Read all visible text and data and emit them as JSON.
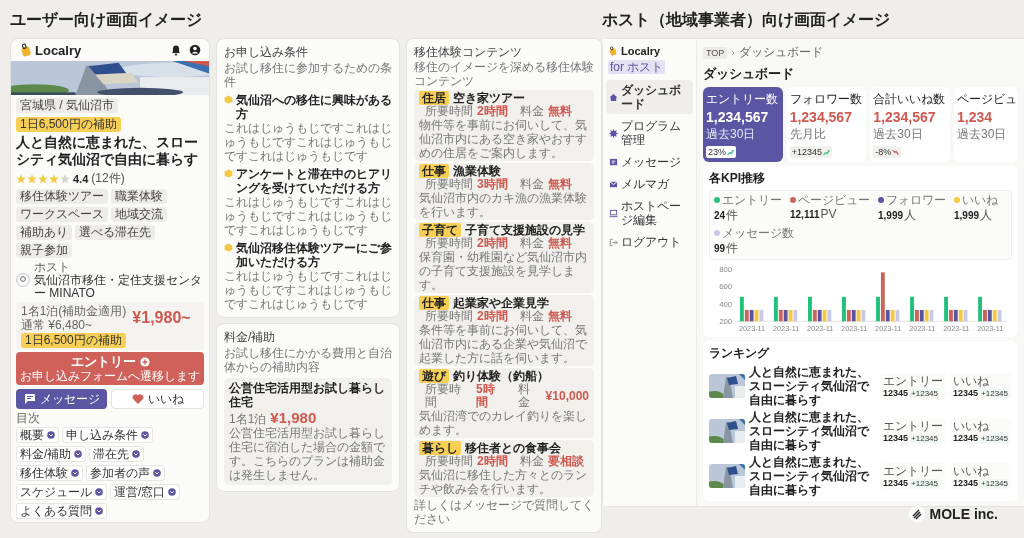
{
  "user_screen": {
    "heading": "ユーザー向け画面イメージ",
    "logo": "Localry",
    "location": "宮城県 / 気仙沼市",
    "subsidy": "1日6,500円の補助",
    "title": "人と自然に恵まれた、スローシティ気仙沼で自由に暮らす",
    "rating": {
      "stars": 4,
      "score": "4.4",
      "count": "(12件)"
    },
    "tags": [
      "移住体験ツアー",
      "職業体験",
      "ワークスペース",
      "地域交流",
      "補助あり",
      "選べる滞在先",
      "親子参加"
    ],
    "host": {
      "label": "ホスト",
      "name": "気仙沼市移住・定住支援センター MINATO"
    },
    "price": {
      "condition": "1名1泊(補助金適用)",
      "regular": "通常 ¥6,480~",
      "amount": "¥1,980~",
      "badge": "1日6,500円の補助"
    },
    "actions": [
      {
        "kind": "entry",
        "label": "エントリー",
        "sub": "お申し込みフォームへ遷移します"
      },
      {
        "kind": "message",
        "label": "メッセージ"
      },
      {
        "kind": "like",
        "label": "いいね"
      }
    ],
    "toc": {
      "title": "目次",
      "items": [
        "概要",
        "申し込み条件",
        "料金/補助",
        "滞在先",
        "移住体験",
        "参加者の声",
        "スケジュール",
        "運営/窓口",
        "よくある質問"
      ]
    }
  },
  "conditions": {
    "title": "お申し込み条件",
    "subtitle": "お試し移住に参加するための条件",
    "items": [
      {
        "title": "気仙沼への移住に興味がある方",
        "description": "これはじゅうもじですこれはじゅうもじですこれはじゅうもじですこれはじゅうもじです"
      },
      {
        "title": "アンケートと滞在中のヒアリングを受けていただける方",
        "description": "これはじゅうもじですこれはじゅうもじですこれはじゅうもじですこれはじゅうもじです"
      },
      {
        "title": "気仙沼移住体験ツアーにご参加いただける方",
        "description": "これはじゅうもじですこれはじゅうもじですこれはじゅうもじですこれはじゅうもじです"
      }
    ]
  },
  "fees": {
    "title": "料金/補助",
    "subtitle": "お試し移住にかかる費用と自治体からの補助内容",
    "plans": [
      {
        "title": "公営住宅活用型お試し暮らし住宅",
        "unit": "1名1泊",
        "amount": "¥1,980",
        "description": "公営住宅活用型お試し暮らし住宅に宿泊した場合の金額です。こちらのプランは補助金は発生しません。"
      }
    ]
  },
  "experiences": {
    "title": "移住体験コンテンツ",
    "subtitle": "移住のイメージを深める移住体験コンテンツ",
    "items": [
      {
        "category": "住居",
        "title": "空き家ツアー",
        "duration_label": "所要時間",
        "duration": "2時間",
        "fee_label": "料金",
        "fee": "無料",
        "description": "物件等を事前にお伺いして、気仙沼市内にある空き家やおすすめの住居をご案内します。"
      },
      {
        "category": "仕事",
        "title": "漁業体験",
        "duration_label": "所要時間",
        "duration": "3時間",
        "fee_label": "料金",
        "fee": "無料",
        "description": "気仙沼市内のカキ漁の漁業体験を行います。"
      },
      {
        "category": "子育て",
        "title": "子育て支援施設の見学",
        "duration_label": "所要時間",
        "duration": "2時間",
        "fee_label": "料金",
        "fee": "無料",
        "description": "保育園・幼稚園など気仙沼市内の子育て支援施設を見学します。"
      },
      {
        "category": "仕事",
        "title": "起業家や企業見学",
        "duration_label": "所要時間",
        "duration": "2時間",
        "fee_label": "料金",
        "fee": "無料",
        "description": "条件等を事前にお伺いして、気仙沼市内にある企業や気仙沼で起業した方に話を伺います。"
      },
      {
        "category": "遊び",
        "title": "釣り体験（釣船）",
        "duration_label": "所要時間",
        "duration": "5時間",
        "fee_label": "料金",
        "fee": "¥10,000",
        "description": "気仙沼湾でのカレイ釣りを楽しめます。"
      },
      {
        "category": "暮らし",
        "title": "移住者との食事会",
        "duration_label": "所要時間",
        "duration": "2時間",
        "fee_label": "料金",
        "fee": "要相談",
        "description": "気仙沼に移住した方々とのランチや飲み会を行います。"
      }
    ],
    "footer": "詳しくはメッセージで質問してください"
  },
  "host_screen": {
    "heading": "ホスト（地域事業者）向け画面イメージ",
    "logo": "Localry",
    "badge": "for ホスト",
    "nav": [
      {
        "kind": "home",
        "label": "ダッシュボード",
        "selected": true
      },
      {
        "kind": "program",
        "label": "プログラム管理",
        "selected": false
      },
      {
        "kind": "message",
        "label": "メッセージ",
        "selected": false
      },
      {
        "kind": "mail",
        "label": "メルマガ",
        "selected": false
      },
      {
        "kind": "page",
        "label": "ホストページ編集",
        "selected": false
      },
      {
        "kind": "logout",
        "label": "ログアウト",
        "selected": false
      }
    ],
    "breadcrumb": [
      "TOP",
      "ダッシュボード"
    ],
    "page_title": "ダッシュボード",
    "kpi_cards": [
      {
        "label": "エントリー数",
        "value": "1,234,567",
        "caption": "過去30日",
        "change": "23%",
        "kind": "up",
        "selected": true
      },
      {
        "label": "フォロワー数",
        "value": "1,234,567",
        "caption": "先月比",
        "change": "+12345",
        "kind": "up",
        "selected": false
      },
      {
        "label": "合計いいね数",
        "value": "1,234,567",
        "caption": "過去30日",
        "change": "-8%",
        "kind": "down",
        "selected": false
      },
      {
        "label": "ページビュ",
        "value": "1,234",
        "caption": "過去30日",
        "selected": false
      }
    ],
    "kpi_trend": {
      "title": "各KPI推移",
      "legend": [
        {
          "value": "24",
          "unit": "件"
        },
        {
          "value": "12,111",
          "unit": "PV"
        },
        {
          "value": "1,999",
          "unit": "人"
        },
        {
          "value": "1,999",
          "unit": "人"
        },
        {
          "value": "99",
          "unit": "件"
        }
      ],
      "chart_data": {
        "type": "bar",
        "categories": [
          "2023-11",
          "2023-11",
          "2023-11",
          "2023-11",
          "2023-11",
          "2023-11",
          "2023-11",
          "2023-11"
        ],
        "ylim": [
          200,
          800
        ],
        "yticks": [
          200,
          400,
          600,
          800
        ],
        "series": [
          {
            "name": "エントリー",
            "color": "#22c07a",
            "values": [
              480,
              480,
              480,
              480,
              480,
              480,
              480,
              480
            ]
          },
          {
            "name": "ページビュー",
            "color": "#c9645a",
            "values": [
              330,
              330,
              330,
              330,
              760,
              330,
              330,
              330
            ]
          },
          {
            "name": "フォロワー",
            "color": "#5a55a0",
            "values": [
              330,
              330,
              330,
              330,
              330,
              330,
              330,
              330
            ]
          },
          {
            "name": "いいね",
            "color": "#f5c842",
            "values": [
              330,
              330,
              330,
              330,
              330,
              330,
              330,
              330
            ]
          },
          {
            "name": "メッセージ数",
            "color": "#c9c9e6",
            "values": [
              330,
              330,
              330,
              330,
              330,
              330,
              330,
              330
            ]
          }
        ]
      }
    },
    "ranking": {
      "title": "ランキング",
      "rows": [
        {
          "title": "人と自然に恵まれた、スローシティ気仙沼で自由に暮らす",
          "stats": [
            {
              "label": "エントリー",
              "value": "12345",
              "change": "+12345"
            },
            {
              "label": "いいね",
              "value": "12345",
              "change": "+12345"
            }
          ]
        },
        {
          "title": "人と自然に恵まれた、スローシティ気仙沼で自由に暮らす",
          "stats": [
            {
              "label": "エントリー",
              "value": "12345",
              "change": "+12345"
            },
            {
              "label": "いいね",
              "value": "12345",
              "change": "+12345"
            }
          ]
        },
        {
          "title": "人と自然に恵まれた、スローシティ気仙沼で自由に暮らす",
          "stats": [
            {
              "label": "エントリー",
              "value": "12345",
              "change": "+12345"
            },
            {
              "label": "いいね",
              "value": "12345",
              "change": "+12345"
            }
          ]
        }
      ]
    }
  },
  "company_logo": "MOLE inc."
}
